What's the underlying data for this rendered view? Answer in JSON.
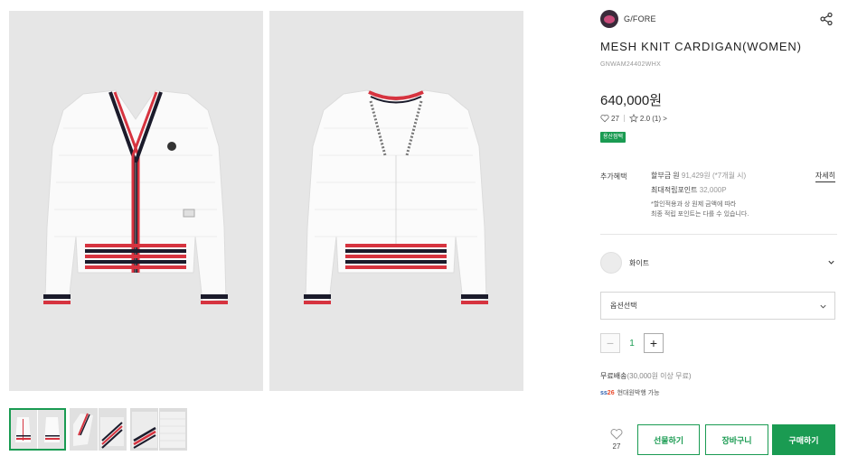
{
  "gallery": {
    "thumbnails": [
      "thumbnail-1",
      "thumbnail-2",
      "thumbnail-3",
      "thumbnail-4"
    ],
    "active_thumbnail": 1
  },
  "brand": {
    "name": "G/FORE"
  },
  "product": {
    "title": "MESH KNIT CARDIGAN(WOMEN)",
    "code": "GNWAM24402WHX",
    "price": "640,000원",
    "likes": "27",
    "rating": "2.0",
    "review_count": "(1)",
    "rating_arrow": ">",
    "badge": "용산점택"
  },
  "benefits": {
    "label": "추가혜택",
    "installment_prefix": "할부금 원",
    "installment_value": "91,429원",
    "installment_suffix": "(*7개월 시)",
    "points_label": "최대적립포인트",
    "points_value": "32,000P",
    "note_line1": "*할인적용과 상 원제 금액에 따라",
    "note_line2": "최종 적립 포인트는 다를 수 있습니다.",
    "more": "자세히"
  },
  "color_option": {
    "name": "화이트"
  },
  "option_select": {
    "placeholder": "옵션선택"
  },
  "quantity": {
    "minus": "−",
    "value": "1",
    "plus": "+"
  },
  "shipping": {
    "label": "무료배송",
    "condition": "(30,000원 이상 무료)",
    "return_badge_a": "ss",
    "return_badge_b": "26",
    "return_text": "현대원박행 가능"
  },
  "actions": {
    "wish_count": "27",
    "gift": "선물하기",
    "cart": "장바구니",
    "buy": "구매하기"
  },
  "colors": {
    "accent": "#1a9b52",
    "stripe_red": "#d6333f",
    "stripe_navy": "#1b1b2b",
    "image_bg": "#e6e6e6"
  }
}
